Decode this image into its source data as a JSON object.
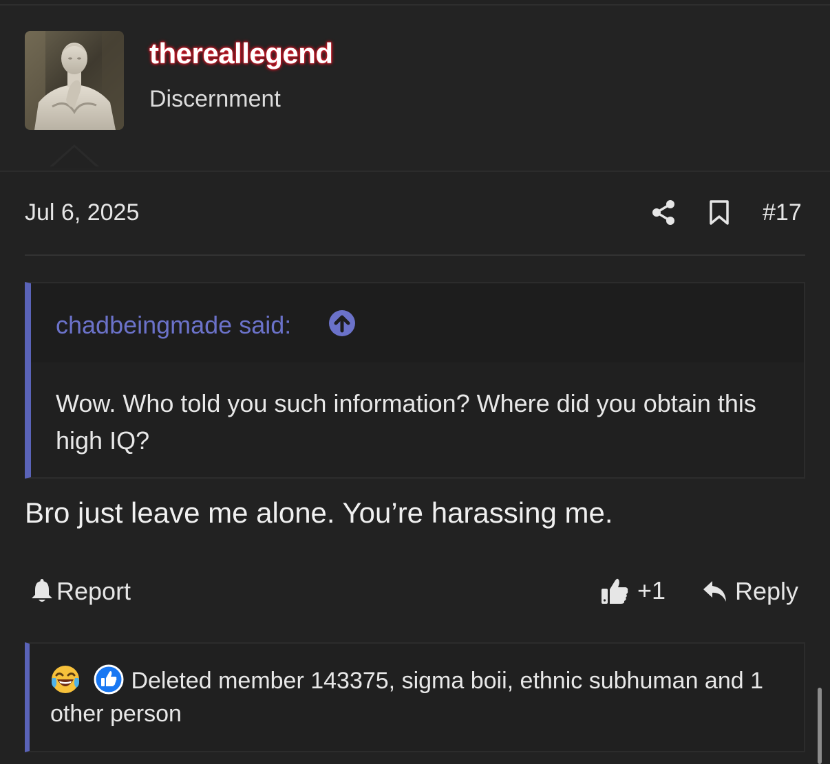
{
  "user": {
    "username": "thereallegend",
    "title": "Discernment"
  },
  "post": {
    "date": "Jul 6, 2025",
    "number": "#17",
    "message": "Bro just leave me alone. You’re harassing me."
  },
  "quote": {
    "author_label": "chadbeingmade said:",
    "body": "Wow. Who told you such information? Where did you obtain this high IQ?"
  },
  "actions": {
    "report_label": "Report",
    "like_count": "+1",
    "reply_label": "Reply"
  },
  "reactions": {
    "text": "Deleted member 143375, sigma boii, ethnic subhuman and 1 other person",
    "icons": [
      "laughing-crying-emoji-icon",
      "like-reaction-icon"
    ]
  },
  "colors": {
    "background": "#222222",
    "accent": "#5a63b8",
    "quote_author": "#6b72c9",
    "username_glow": "#e01a2b"
  },
  "icons": [
    "share-icon",
    "bookmark-icon",
    "arrow-up-circle-icon",
    "bell-icon",
    "thumbs-up-icon",
    "reply-arrow-icon"
  ]
}
